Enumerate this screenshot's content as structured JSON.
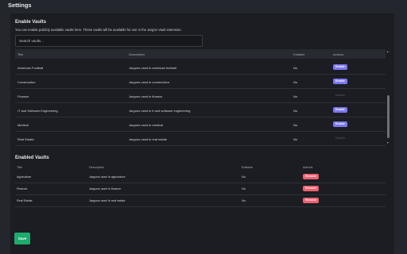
{
  "page": {
    "title": "Settings"
  },
  "enable_section": {
    "title": "Enable Vaults",
    "description": "You can enable publicly available vaults here. These vaults will be available for use in the Jargon Vault extension.",
    "search_placeholder": "Search vaults...",
    "headers": {
      "title": "Title",
      "description": "Description",
      "editable": "Editable",
      "actions": "Actions"
    },
    "rows": [
      {
        "title": "American Football",
        "description": "Jargons used in american football",
        "editable": "No",
        "action": "Enable",
        "action_enabled": true
      },
      {
        "title": "Construction",
        "description": "Jargons used in construction",
        "editable": "No",
        "action": "Enable",
        "action_enabled": true
      },
      {
        "title": "Finance",
        "description": "Jargons used in finance",
        "editable": "No",
        "action": "Disable",
        "action_enabled": false
      },
      {
        "title": "IT and Software Engineering",
        "description": "Jargons used in it and software engineering",
        "editable": "No",
        "action": "Enable",
        "action_enabled": true
      },
      {
        "title": "Medical",
        "description": "Jargons used in medical",
        "editable": "No",
        "action": "Enable",
        "action_enabled": true
      },
      {
        "title": "Real Estate",
        "description": "Jargons used in real estate",
        "editable": "No",
        "action": "Disable",
        "action_enabled": false
      }
    ]
  },
  "enabled_section": {
    "title": "Enabled Vaults",
    "headers": {
      "title": "Title",
      "description": "Description",
      "editable": "Editable",
      "actions": "Actions"
    },
    "rows": [
      {
        "title": "Agriculture",
        "description": "Jargons used in agriculture",
        "editable": "No",
        "action": "Remove"
      },
      {
        "title": "Finance",
        "description": "Jargons used in finance",
        "editable": "No",
        "action": "Remove"
      },
      {
        "title": "Real Estate",
        "description": "Jargons used in real estate",
        "editable": "No",
        "action": "Remove"
      }
    ]
  },
  "save_label": "Save",
  "colors": {
    "background": "#23262d",
    "panel": "#1b1d22",
    "enable_button": "#7c78f2",
    "remove_button": "#f05f6e",
    "save_button": "#1faa6e"
  },
  "icons": {
    "scroll_up": "triangle-up-icon",
    "scroll_down": "triangle-down-icon"
  }
}
